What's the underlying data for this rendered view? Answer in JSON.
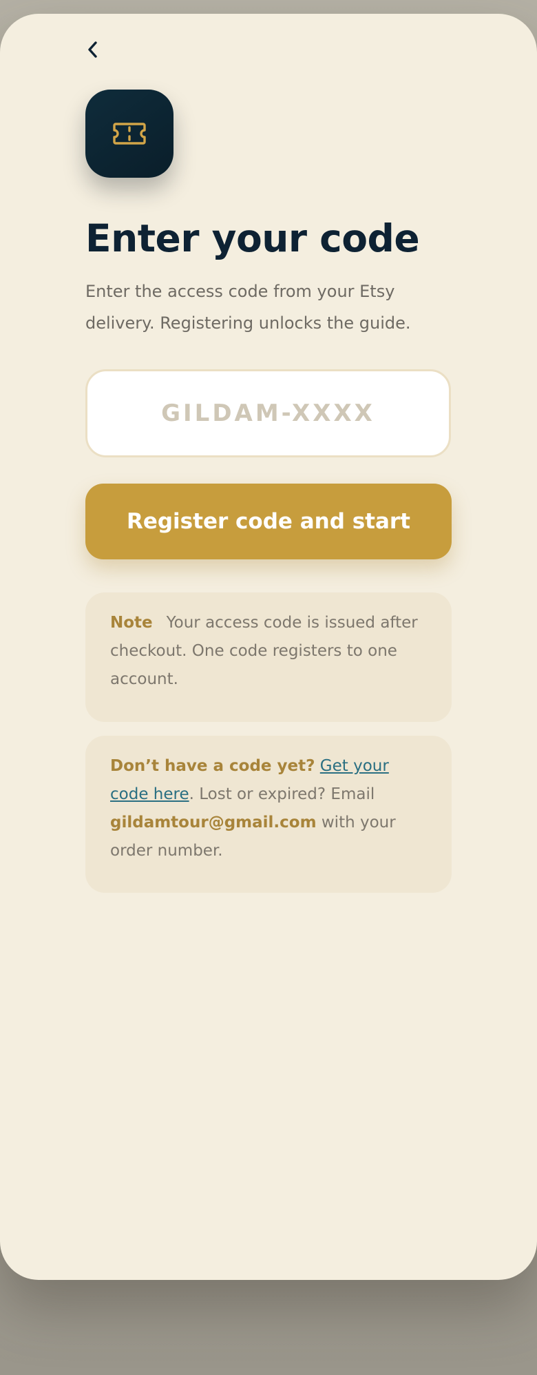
{
  "header": {
    "back_icon": "chevron-left-icon",
    "app_icon": "ticket-icon"
  },
  "colors": {
    "accent": "#c79d3d",
    "heading": "#0e2233",
    "background": "#f4eedf",
    "icon_tile": "#0f2c3b",
    "link": "#2a6f82"
  },
  "main": {
    "title": "Enter your code",
    "subtitle": "Enter the access code from your Etsy delivery. Registering unlocks the guide.",
    "code_input": {
      "placeholder": "GILDAM-XXXX",
      "value": ""
    },
    "register_button_label": "Register code and start"
  },
  "note": {
    "label": "Note",
    "text": "Your access code is issued after checkout. One code registers to one account."
  },
  "help": {
    "question": "Don’t have a code yet?",
    "link_text": "Get your code here",
    "after_link": ". Lost or expired? Email ",
    "email": "gildamtour@gmail.com",
    "tail": " with your order number."
  }
}
